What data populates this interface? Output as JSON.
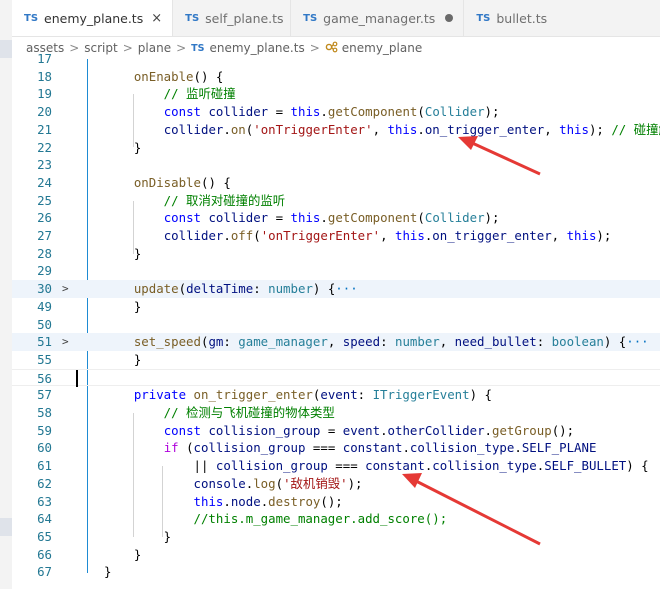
{
  "tabs": [
    {
      "label": "enemy_plane.ts",
      "icon": "TS",
      "active": true,
      "indicator": "×"
    },
    {
      "label": "self_plane.ts",
      "icon": "TS",
      "active": false,
      "indicator": ""
    },
    {
      "label": "game_manager.ts",
      "icon": "TS",
      "active": false,
      "indicator": "●"
    },
    {
      "label": "bullet.ts",
      "icon": "TS",
      "active": false,
      "indicator": ""
    }
  ],
  "breadcrumb": {
    "segments": [
      "assets",
      "script",
      "plane"
    ],
    "separator": ">",
    "file_icon": "TS",
    "file": "enemy_plane.ts",
    "symbol": "enemy_plane"
  },
  "colors": {
    "keyword": "#0000ff",
    "control": "#af00db",
    "function": "#795e26",
    "string": "#a31515",
    "comment": "#008000",
    "type": "#267f99",
    "line_number": "#237893",
    "annotation_arrow": "#e53935"
  },
  "lines": [
    {
      "n": "17",
      "fold": "",
      "hl": false,
      "tokens": []
    },
    {
      "n": "18",
      "fold": "",
      "hl": false,
      "tokens": [
        {
          "t": "    onEnable",
          "c": "fn"
        },
        {
          "t": "() {",
          "c": ""
        }
      ]
    },
    {
      "n": "19",
      "fold": "",
      "hl": false,
      "tokens": [
        {
          "t": "        // 监听碰撞",
          "c": "cm"
        }
      ]
    },
    {
      "n": "20",
      "fold": "",
      "hl": false,
      "tokens": [
        {
          "t": "        ",
          "c": ""
        },
        {
          "t": "const",
          "c": "kw"
        },
        {
          "t": " ",
          "c": ""
        },
        {
          "t": "collider",
          "c": "pr"
        },
        {
          "t": " = ",
          "c": ""
        },
        {
          "t": "this",
          "c": "kw"
        },
        {
          "t": ".",
          "c": ""
        },
        {
          "t": "getComponent",
          "c": "fn"
        },
        {
          "t": "(",
          "c": ""
        },
        {
          "t": "Collider",
          "c": "ty"
        },
        {
          "t": ");",
          "c": ""
        }
      ]
    },
    {
      "n": "21",
      "fold": "",
      "hl": false,
      "tokens": [
        {
          "t": "        ",
          "c": ""
        },
        {
          "t": "collider",
          "c": "pr"
        },
        {
          "t": ".",
          "c": ""
        },
        {
          "t": "on",
          "c": "fn"
        },
        {
          "t": "(",
          "c": ""
        },
        {
          "t": "'onTriggerEnter'",
          "c": "str"
        },
        {
          "t": ", ",
          "c": ""
        },
        {
          "t": "this",
          "c": "kw"
        },
        {
          "t": ".",
          "c": ""
        },
        {
          "t": "on_trigger_enter",
          "c": "pr"
        },
        {
          "t": ", ",
          "c": ""
        },
        {
          "t": "this",
          "c": "kw"
        },
        {
          "t": "); ",
          "c": ""
        },
        {
          "t": "// 碰撞触发",
          "c": "cm"
        }
      ]
    },
    {
      "n": "22",
      "fold": "",
      "hl": false,
      "tokens": [
        {
          "t": "    }",
          "c": ""
        }
      ]
    },
    {
      "n": "23",
      "fold": "",
      "hl": false,
      "tokens": []
    },
    {
      "n": "24",
      "fold": "",
      "hl": false,
      "tokens": [
        {
          "t": "    onDisable",
          "c": "fn"
        },
        {
          "t": "() {",
          "c": ""
        }
      ]
    },
    {
      "n": "25",
      "fold": "",
      "hl": false,
      "tokens": [
        {
          "t": "        // 取消对碰撞的监听",
          "c": "cm"
        }
      ]
    },
    {
      "n": "26",
      "fold": "",
      "hl": false,
      "tokens": [
        {
          "t": "        ",
          "c": ""
        },
        {
          "t": "const",
          "c": "kw"
        },
        {
          "t": " ",
          "c": ""
        },
        {
          "t": "collider",
          "c": "pr"
        },
        {
          "t": " = ",
          "c": ""
        },
        {
          "t": "this",
          "c": "kw"
        },
        {
          "t": ".",
          "c": ""
        },
        {
          "t": "getComponent",
          "c": "fn"
        },
        {
          "t": "(",
          "c": ""
        },
        {
          "t": "Collider",
          "c": "ty"
        },
        {
          "t": ");",
          "c": ""
        }
      ]
    },
    {
      "n": "27",
      "fold": "",
      "hl": false,
      "tokens": [
        {
          "t": "        ",
          "c": ""
        },
        {
          "t": "collider",
          "c": "pr"
        },
        {
          "t": ".",
          "c": ""
        },
        {
          "t": "off",
          "c": "fn"
        },
        {
          "t": "(",
          "c": ""
        },
        {
          "t": "'onTriggerEnter'",
          "c": "str"
        },
        {
          "t": ", ",
          "c": ""
        },
        {
          "t": "this",
          "c": "kw"
        },
        {
          "t": ".",
          "c": ""
        },
        {
          "t": "on_trigger_enter",
          "c": "pr"
        },
        {
          "t": ", ",
          "c": ""
        },
        {
          "t": "this",
          "c": "kw"
        },
        {
          "t": ");",
          "c": ""
        }
      ]
    },
    {
      "n": "28",
      "fold": "",
      "hl": false,
      "tokens": [
        {
          "t": "    }",
          "c": ""
        }
      ]
    },
    {
      "n": "29",
      "fold": "",
      "hl": false,
      "tokens": []
    },
    {
      "n": "30",
      "fold": ">",
      "hl": true,
      "tokens": [
        {
          "t": "    update",
          "c": "fn"
        },
        {
          "t": "(",
          "c": ""
        },
        {
          "t": "deltaTime",
          "c": "pr"
        },
        {
          "t": ": ",
          "c": ""
        },
        {
          "t": "number",
          "c": "ty"
        },
        {
          "t": ") {",
          "c": ""
        },
        {
          "t": "···",
          "c": "ellip"
        }
      ]
    },
    {
      "n": "49",
      "fold": "",
      "hl": false,
      "tokens": [
        {
          "t": "    }",
          "c": ""
        }
      ]
    },
    {
      "n": "50",
      "fold": "",
      "hl": false,
      "tokens": []
    },
    {
      "n": "51",
      "fold": ">",
      "hl": true,
      "tokens": [
        {
          "t": "    set_speed",
          "c": "fn"
        },
        {
          "t": "(",
          "c": ""
        },
        {
          "t": "gm",
          "c": "pr"
        },
        {
          "t": ": ",
          "c": ""
        },
        {
          "t": "game_manager",
          "c": "ty"
        },
        {
          "t": ", ",
          "c": ""
        },
        {
          "t": "speed",
          "c": "pr"
        },
        {
          "t": ": ",
          "c": ""
        },
        {
          "t": "number",
          "c": "ty"
        },
        {
          "t": ", ",
          "c": ""
        },
        {
          "t": "need_bullet",
          "c": "pr"
        },
        {
          "t": ": ",
          "c": ""
        },
        {
          "t": "boolean",
          "c": "ty"
        },
        {
          "t": ") {",
          "c": ""
        },
        {
          "t": "···",
          "c": "ellip"
        }
      ]
    },
    {
      "n": "55",
      "fold": "",
      "hl": false,
      "tokens": [
        {
          "t": "    }",
          "c": ""
        }
      ]
    },
    {
      "n": "56",
      "fold": "",
      "hl": false,
      "cur": true,
      "tokens": []
    },
    {
      "n": "57",
      "fold": "",
      "hl": false,
      "tokens": [
        {
          "t": "    ",
          "c": ""
        },
        {
          "t": "private",
          "c": "kw"
        },
        {
          "t": " ",
          "c": ""
        },
        {
          "t": "on_trigger_enter",
          "c": "fn"
        },
        {
          "t": "(",
          "c": ""
        },
        {
          "t": "event",
          "c": "pr"
        },
        {
          "t": ": ",
          "c": ""
        },
        {
          "t": "ITriggerEvent",
          "c": "ty"
        },
        {
          "t": ") {",
          "c": ""
        }
      ]
    },
    {
      "n": "58",
      "fold": "",
      "hl": false,
      "tokens": [
        {
          "t": "        // 检测与飞机碰撞的物体类型",
          "c": "cm"
        }
      ]
    },
    {
      "n": "59",
      "fold": "",
      "hl": false,
      "tokens": [
        {
          "t": "        ",
          "c": ""
        },
        {
          "t": "const",
          "c": "kw"
        },
        {
          "t": " ",
          "c": ""
        },
        {
          "t": "collision_group",
          "c": "pr"
        },
        {
          "t": " = ",
          "c": ""
        },
        {
          "t": "event",
          "c": "pr"
        },
        {
          "t": ".",
          "c": ""
        },
        {
          "t": "otherCollider",
          "c": "pr"
        },
        {
          "t": ".",
          "c": ""
        },
        {
          "t": "getGroup",
          "c": "fn"
        },
        {
          "t": "();",
          "c": ""
        }
      ]
    },
    {
      "n": "60",
      "fold": "",
      "hl": false,
      "tokens": [
        {
          "t": "        ",
          "c": ""
        },
        {
          "t": "if",
          "c": "kw2"
        },
        {
          "t": " (",
          "c": ""
        },
        {
          "t": "collision_group",
          "c": "pr"
        },
        {
          "t": " === ",
          "c": ""
        },
        {
          "t": "constant",
          "c": "pr"
        },
        {
          "t": ".",
          "c": ""
        },
        {
          "t": "collision_type",
          "c": "pr"
        },
        {
          "t": ".",
          "c": ""
        },
        {
          "t": "SELF_PLANE",
          "c": "pr"
        }
      ]
    },
    {
      "n": "61",
      "fold": "",
      "hl": false,
      "tokens": [
        {
          "t": "            || ",
          "c": ""
        },
        {
          "t": "collision_group",
          "c": "pr"
        },
        {
          "t": " === ",
          "c": ""
        },
        {
          "t": "constant",
          "c": "pr"
        },
        {
          "t": ".",
          "c": ""
        },
        {
          "t": "collision_type",
          "c": "pr"
        },
        {
          "t": ".",
          "c": ""
        },
        {
          "t": "SELF_BULLET",
          "c": "pr"
        },
        {
          "t": ") {",
          "c": ""
        }
      ]
    },
    {
      "n": "62",
      "fold": "",
      "hl": false,
      "tokens": [
        {
          "t": "            ",
          "c": ""
        },
        {
          "t": "console",
          "c": "pr"
        },
        {
          "t": ".",
          "c": ""
        },
        {
          "t": "log",
          "c": "fn"
        },
        {
          "t": "(",
          "c": ""
        },
        {
          "t": "'敌机销毁'",
          "c": "str"
        },
        {
          "t": ");",
          "c": ""
        }
      ]
    },
    {
      "n": "63",
      "fold": "",
      "hl": false,
      "tokens": [
        {
          "t": "            ",
          "c": ""
        },
        {
          "t": "this",
          "c": "kw"
        },
        {
          "t": ".",
          "c": ""
        },
        {
          "t": "node",
          "c": "pr"
        },
        {
          "t": ".",
          "c": ""
        },
        {
          "t": "destroy",
          "c": "fn"
        },
        {
          "t": "();",
          "c": ""
        }
      ]
    },
    {
      "n": "64",
      "fold": "",
      "hl": false,
      "tokens": [
        {
          "t": "            //this.m_game_manager.add_score();",
          "c": "cm"
        }
      ]
    },
    {
      "n": "65",
      "fold": "",
      "hl": false,
      "tokens": [
        {
          "t": "        }",
          "c": ""
        }
      ]
    },
    {
      "n": "66",
      "fold": "",
      "hl": false,
      "tokens": [
        {
          "t": "    }",
          "c": ""
        }
      ]
    },
    {
      "n": "67",
      "fold": "",
      "hl": false,
      "tokens": [
        {
          "t": "}",
          "c": ""
        }
      ]
    }
  ]
}
